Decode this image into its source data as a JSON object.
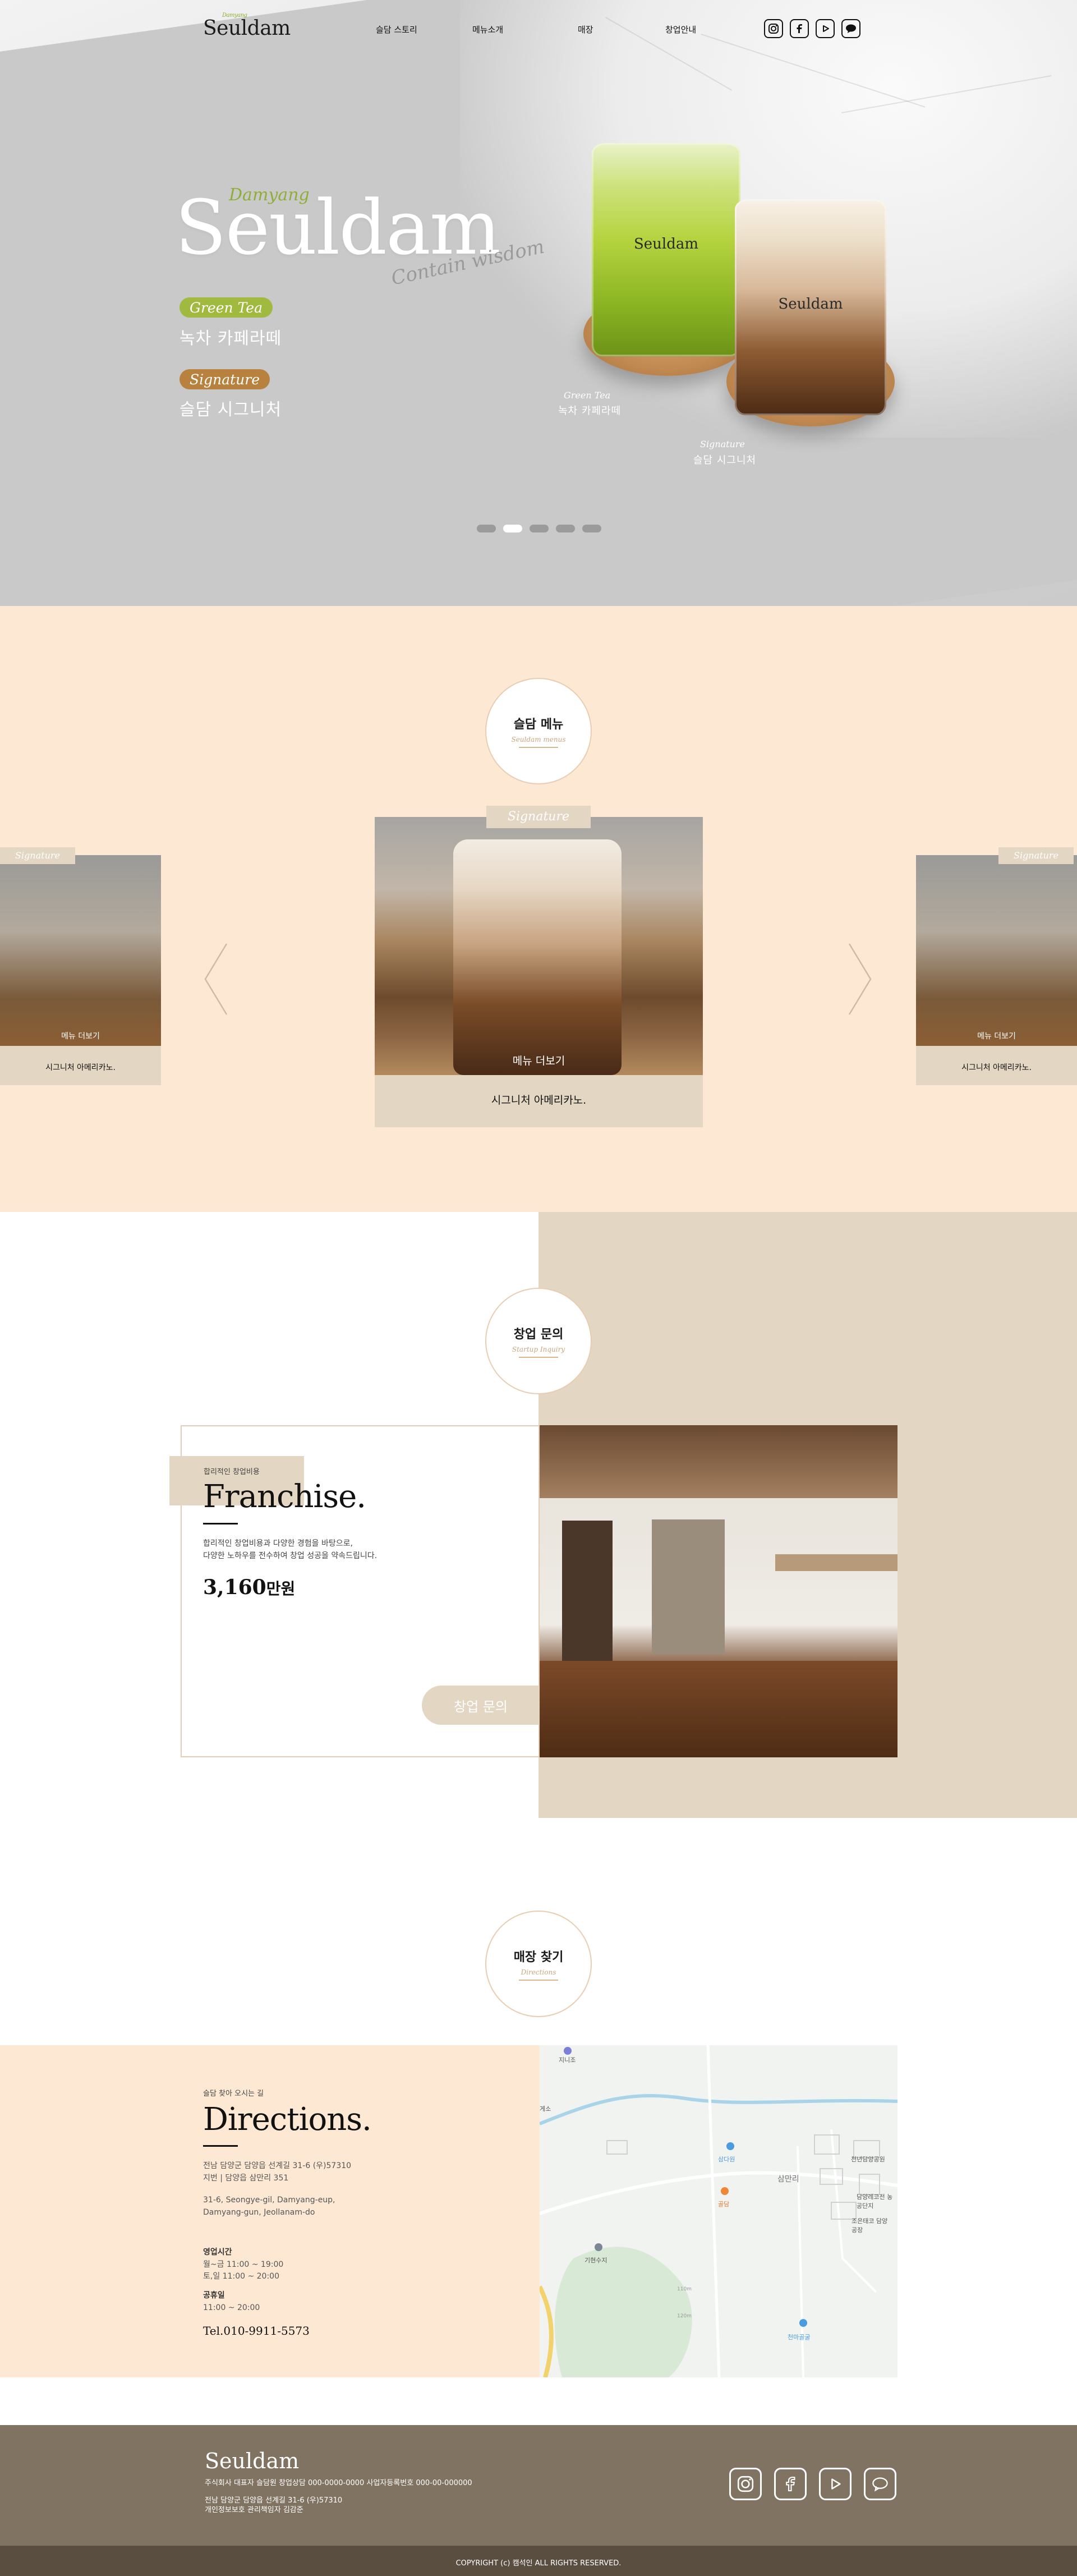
{
  "brand": {
    "logo": "Seuldam",
    "logo_small": "Damyang"
  },
  "nav": {
    "items": [
      "슬담 스토리",
      "메뉴소개",
      "매장",
      "창업안내"
    ],
    "sns": [
      "instagram-icon",
      "facebook-icon",
      "youtube-icon",
      "talk-icon"
    ]
  },
  "hero": {
    "small_title": "Damyang",
    "title": "Seuldam",
    "tagline": "Contain wisdom",
    "items": [
      {
        "pill": "Green Tea",
        "name": "녹차 카페라떼",
        "color": "#9fba3f"
      },
      {
        "pill": "Signature",
        "name": "슬담 시그니처",
        "color": "#b8823e"
      }
    ],
    "captions": [
      {
        "en": "Green Tea",
        "ko": "녹차 카페라떼"
      },
      {
        "en": "Signature",
        "ko": "슬담 시그니처"
      }
    ],
    "cup_brand": "Seuldam",
    "slides": 5,
    "active_slide": 2
  },
  "menu": {
    "title_ko": "슬담 메뉴",
    "title_en": "Seuldam menus",
    "cards": [
      {
        "tag": "Signature",
        "more": "메뉴 더보기",
        "desc": "시그니처 아메리카노."
      },
      {
        "tag": "Signature",
        "more": "메뉴 더보기",
        "desc": "시그니처 아메리카노."
      },
      {
        "tag": "Signature",
        "more": "메뉴 더보기",
        "desc": "시그니처 아메리카노."
      }
    ]
  },
  "startup": {
    "title_ko": "창업 문의",
    "title_en": "Startup Inquiry",
    "small": "합리적인 창업비용",
    "heading": "Franchise",
    "desc_1": "합리적인 창업비용과 다양한 경험을 바탕으로,",
    "desc_2": "다양한 노하우를 전수하여 창업 성공을 약속드립니다.",
    "price": "3,160",
    "price_unit": "만원",
    "button": "창업 문의"
  },
  "store": {
    "title_ko": "매장 찾기",
    "title_en": "Directions",
    "small": "슬담 찾아 오시는 길",
    "heading": "Directions",
    "address_1": "전남 담양군 담양읍 선계길 31-6 (우)57310",
    "address_2": "지번 | 담양읍 삼만리 351",
    "address_en_1": "31-6, Seongye-gil, Damyang-eup,",
    "address_en_2": "Damyang-gun, Jeollanam-do",
    "hours_label": "영업시간",
    "hours_1": "월~금 11:00 ~ 19:00",
    "hours_2": "토,일 11:00 ~ 20:00",
    "holiday_label": "공휴일",
    "holiday_hours": "11:00 ~ 20:00",
    "tel": "Tel.010-9911-5573",
    "map_labels": [
      "지니조",
      "삼다원",
      "골담",
      "삼만리",
      "기현수지",
      "천년담양공원",
      "담양레코전 농공단지",
      "조은태코 담양공장",
      "천마골굴",
      "110m",
      "120m",
      "게소"
    ]
  },
  "footer": {
    "logo": "Seuldam",
    "line_1": "주식회사     대표자 슬담원     창업상담 000-0000-0000     사업자등록번호 000-00-000000",
    "line_2": "전남 담양군 담양읍 선계길 31-6 (우)57310",
    "line_3": "개인정보보호 관리책임자 김감준",
    "copyright": "COPYRIGHT (c) 캠석인  ALL RIGHTS RESERVED."
  },
  "colors": {
    "cream": "#fde9d3",
    "taupe": "#e3d6c3",
    "footer": "#817361",
    "copyright_bar": "#5a4e41",
    "green": "#9fba3f",
    "bronze": "#b8823e"
  }
}
